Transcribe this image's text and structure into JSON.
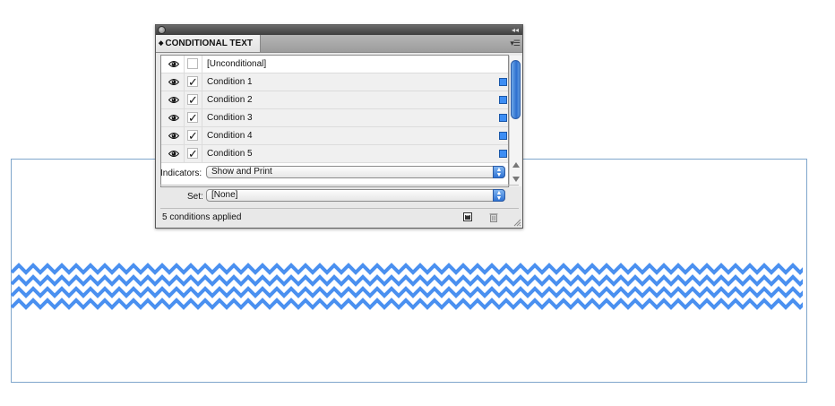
{
  "panel": {
    "tab_title": "CONDITIONAL TEXT",
    "rows": [
      {
        "label": "[Unconditional]",
        "checked": false,
        "swatch": false
      },
      {
        "label": "Condition 1",
        "checked": true,
        "swatch": true
      },
      {
        "label": "Condition 2",
        "checked": true,
        "swatch": true
      },
      {
        "label": "Condition 3",
        "checked": true,
        "swatch": true
      },
      {
        "label": "Condition 4",
        "checked": true,
        "swatch": true
      },
      {
        "label": "Condition 5",
        "checked": true,
        "swatch": true
      }
    ],
    "check_glyph": "✓",
    "indicators_label": "Indicators:",
    "indicators_value": "Show and Print",
    "set_label": "Set:",
    "set_value": "[None]",
    "status": "5 conditions applied"
  },
  "colors": {
    "condition_swatch": "#3d8ef4",
    "zigzag": "#4a90f0",
    "frame_border": "#7fa6cc"
  },
  "icons": {
    "visibility": "eye-icon",
    "new_condition": "new-condition-icon",
    "delete_condition": "trash-icon",
    "panel_menu": "panel-menu-icon"
  }
}
